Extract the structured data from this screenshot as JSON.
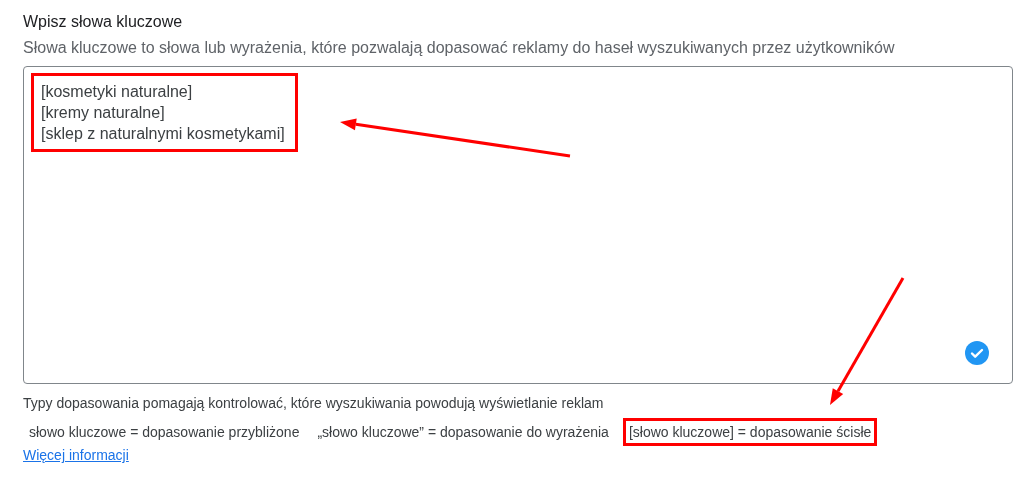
{
  "title": "Wpisz słowa kluczowe",
  "description": "Słowa kluczowe to słowa lub wyrażenia, które pozwalają dopasować reklamy do haseł wyszukiwanych przez użytkowników",
  "keywords_field": {
    "highlighted": true,
    "valid": true,
    "lines": [
      "[kosmetyki naturalne]",
      "[kremy naturalne]",
      "[sklep z naturalnymi kosmetykami]"
    ]
  },
  "hint": "Typy dopasowania pomagają kontrolować, które wyszukiwania powodują wyświetlanie reklam",
  "match_types": [
    {
      "text": "słowo kluczowe = dopasowanie przybliżone",
      "highlighted": false
    },
    {
      "text": "„słowo kluczowe” = dopasowanie do wyrażenia",
      "highlighted": false
    },
    {
      "text": "[słowo kluczowe] = dopasowanie ścisłe",
      "highlighted": true
    }
  ],
  "link": "Więcej informacji"
}
